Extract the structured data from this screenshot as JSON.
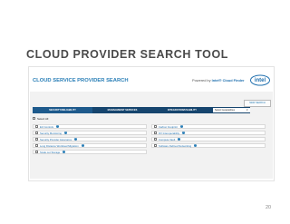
{
  "slide": {
    "title": "CLOUD PROVIDER SEARCH TOOL",
    "page_number": "20"
  },
  "app": {
    "title": "CLOUD SERVICE PROVIDER SEARCH",
    "powered_by": "Powered by",
    "brand": "Intel® Cloud Finder",
    "logo_text": "intel",
    "new_search": "NEW SEARCH",
    "tabs": [
      {
        "label": "SECURITY/RELIABILITY"
      },
      {
        "label": "MANAGEMENT SERVICES"
      },
      {
        "label": "INTEGRATION/USABILITY"
      }
    ],
    "geo_select": "Select Geographies",
    "select_all": "Select All",
    "options": [
      {
        "label": "EU Controls",
        "info": true
      },
      {
        "label": "Carbon Footprint",
        "info": true
      },
      {
        "label": "Security Monitoring",
        "info": true
      },
      {
        "label": "DV Interoperability",
        "info": true
      },
      {
        "label": "Security Provider Assurance",
        "info": true
      },
      {
        "label": "Compute Vault",
        "info": true
      },
      {
        "label": "Long Distance Workload Migration",
        "info": true
      },
      {
        "label": "Software Defined Networking",
        "info": true
      },
      {
        "label": "Scale out Storage",
        "info": true
      }
    ]
  },
  "colors": {
    "accent": "#2a7fb7",
    "tab_bar": "#16456e",
    "logo": "#1f6fae"
  }
}
